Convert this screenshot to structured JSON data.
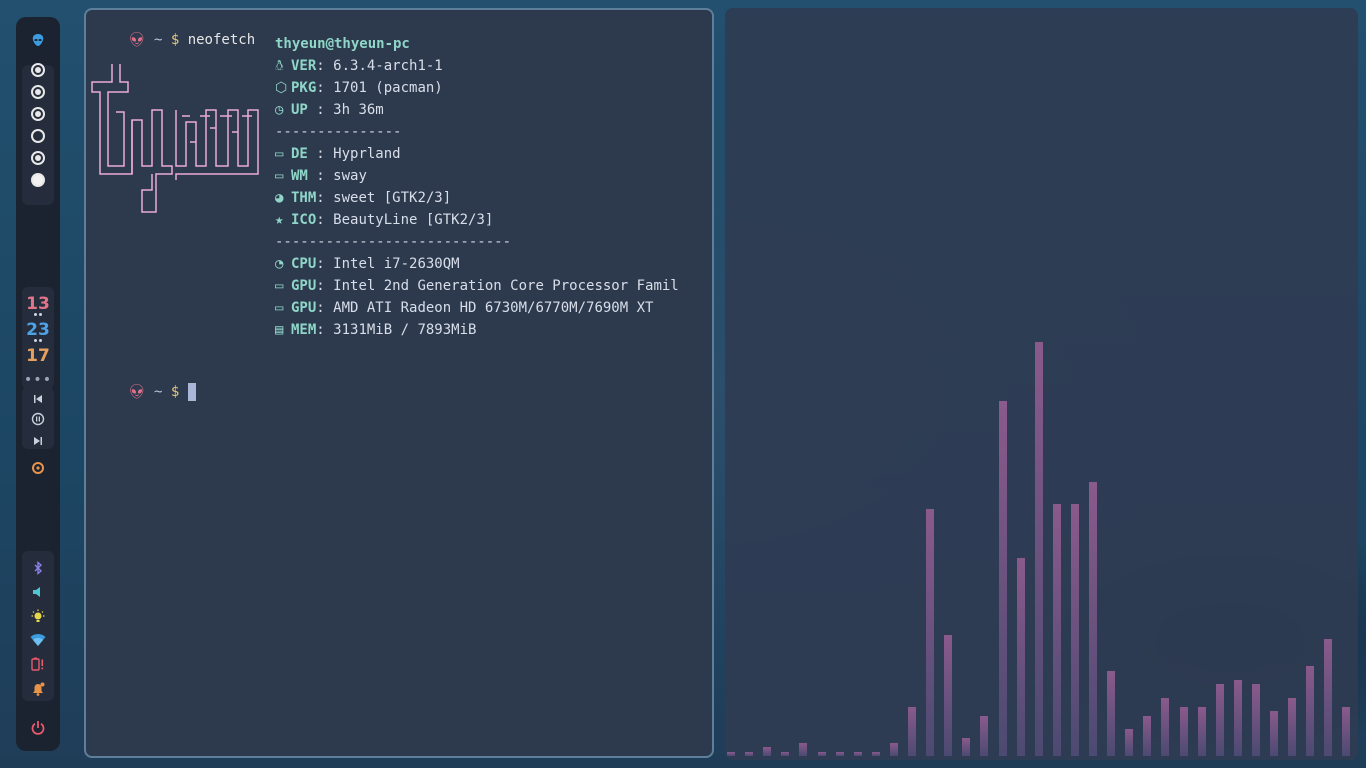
{
  "bar": {
    "logo_icon": "alien-icon",
    "workspaces": [
      {
        "state": "occupied"
      },
      {
        "state": "occupied"
      },
      {
        "state": "occupied"
      },
      {
        "state": "empty"
      },
      {
        "state": "occupied"
      },
      {
        "state": "active"
      }
    ],
    "clock": {
      "hour": "13",
      "minute": "23",
      "second": "17"
    },
    "media": {
      "prev_icon": "skip-back-icon",
      "pause_icon": "pause-icon",
      "next_icon": "skip-forward-icon"
    },
    "tray": [
      "bluetooth-icon",
      "volume-icon",
      "brightness-icon",
      "wifi-icon",
      "battery-alert-icon",
      "bell-icon"
    ],
    "power_icon": "power-icon"
  },
  "terminal": {
    "command_prompt": {
      "symbol": "~",
      "dollar": "$",
      "command": "neofetch"
    },
    "title": "thyeun@thyeun-pc",
    "rows": [
      {
        "key": "VER",
        "sep": ": ",
        "value": "6.3.4-arch1-1",
        "icon": "tux-icon"
      },
      {
        "key": "PKG",
        "sep": ": ",
        "value": "1701 (pacman)",
        "icon": "package-icon"
      },
      {
        "key": "UP ",
        "sep": ": ",
        "value": "3h 36m",
        "icon": "clock-icon"
      },
      {
        "divider": "---------------"
      },
      {
        "key": "DE ",
        "sep": ": ",
        "value": "Hyprland",
        "icon": "window-icon"
      },
      {
        "key": "WM ",
        "sep": ": ",
        "value": "sway",
        "icon": "window-icon"
      },
      {
        "key": "THM",
        "sep": ": ",
        "value": "sweet [GTK2/3]",
        "icon": "palette-icon"
      },
      {
        "key": "ICO",
        "sep": ": ",
        "value": "BeautyLine [GTK2/3]",
        "icon": "star-icon"
      },
      {
        "divider": "----------------------------"
      },
      {
        "key": "CPU",
        "sep": ": ",
        "value": "Intel i7-2630QM",
        "icon": "speedometer-icon"
      },
      {
        "key": "GPU",
        "sep": ": ",
        "value": "Intel 2nd Generation Core Processor Famil",
        "icon": "monitor-icon"
      },
      {
        "key": "GPU",
        "sep": ": ",
        "value": "AMD ATI Radeon HD 6730M/6770M/7690M XT",
        "icon": "monitor-icon"
      },
      {
        "key": "MEM",
        "sep": ": ",
        "value": "3131MiB / 7893MiB",
        "icon": "memory-chip-icon"
      }
    ],
    "ascii_logo_text": "thyeun",
    "second_prompt": {
      "symbol": "~",
      "dollar": "$"
    }
  },
  "visualizer": {
    "levels": [
      0.01,
      0.01,
      0.02,
      0.01,
      0.03,
      0.01,
      0.01,
      0.01,
      0.01,
      0.03,
      0.11,
      0.55,
      0.27,
      0.04,
      0.09,
      0.79,
      0.44,
      0.92,
      0.56,
      0.56,
      0.61,
      0.19,
      0.06,
      0.09,
      0.13,
      0.11,
      0.11,
      0.16,
      0.17,
      0.16,
      0.1,
      0.13,
      0.2,
      0.26,
      0.11
    ],
    "colors": {
      "top": "#8a5a8c",
      "bottom": "#4c4a72"
    }
  }
}
